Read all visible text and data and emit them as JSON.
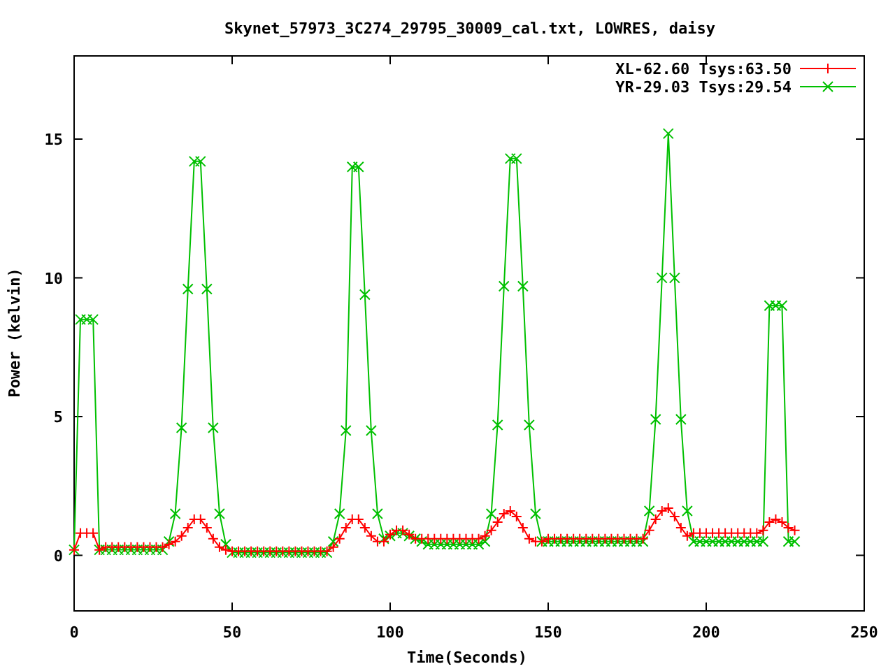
{
  "chart_data": {
    "type": "line",
    "title": "Skynet_57973_3C274_29795_30009_cal.txt, LOWRES, daisy",
    "xlabel": "Time(Seconds)",
    "ylabel": "Power (kelvin)",
    "legend": true,
    "xlim": [
      0,
      250
    ],
    "ylim": [
      -2,
      18
    ],
    "xticks": [
      0,
      50,
      100,
      150,
      200,
      250
    ],
    "yticks": [
      0,
      5,
      10,
      15
    ],
    "x": [
      0,
      2,
      4,
      6,
      8,
      10,
      12,
      14,
      16,
      18,
      20,
      22,
      24,
      26,
      28,
      30,
      32,
      34,
      36,
      38,
      40,
      42,
      44,
      46,
      48,
      50,
      52,
      54,
      56,
      58,
      60,
      62,
      64,
      66,
      68,
      70,
      72,
      74,
      76,
      78,
      80,
      82,
      84,
      86,
      88,
      90,
      92,
      94,
      96,
      98,
      100,
      102,
      104,
      106,
      108,
      110,
      112,
      114,
      116,
      118,
      120,
      122,
      124,
      126,
      128,
      130,
      132,
      134,
      136,
      138,
      140,
      142,
      144,
      146,
      148,
      150,
      152,
      154,
      156,
      158,
      160,
      162,
      164,
      166,
      168,
      170,
      172,
      174,
      176,
      178,
      180,
      182,
      184,
      186,
      188,
      190,
      192,
      194,
      196,
      198,
      200,
      202,
      204,
      206,
      208,
      210,
      212,
      214,
      216,
      218,
      220,
      222,
      224,
      226,
      228
    ],
    "series": [
      {
        "name": "XL-62.60 Tsys:63.50",
        "color": "#ff0000",
        "marker": "plus",
        "values": [
          0.2,
          0.8,
          0.8,
          0.8,
          0.2,
          0.3,
          0.3,
          0.3,
          0.3,
          0.3,
          0.3,
          0.3,
          0.3,
          0.3,
          0.3,
          0.4,
          0.5,
          0.7,
          1.0,
          1.3,
          1.3,
          1.0,
          0.6,
          0.3,
          0.2,
          0.15,
          0.15,
          0.15,
          0.15,
          0.15,
          0.15,
          0.15,
          0.15,
          0.15,
          0.15,
          0.15,
          0.15,
          0.15,
          0.15,
          0.15,
          0.15,
          0.3,
          0.6,
          1.0,
          1.3,
          1.3,
          1.0,
          0.7,
          0.5,
          0.5,
          0.75,
          0.9,
          0.9,
          0.75,
          0.6,
          0.6,
          0.6,
          0.6,
          0.6,
          0.6,
          0.6,
          0.6,
          0.6,
          0.6,
          0.6,
          0.7,
          0.9,
          1.2,
          1.5,
          1.6,
          1.4,
          1.0,
          0.6,
          0.5,
          0.5,
          0.6,
          0.6,
          0.6,
          0.6,
          0.6,
          0.6,
          0.6,
          0.6,
          0.6,
          0.6,
          0.6,
          0.6,
          0.6,
          0.6,
          0.6,
          0.6,
          0.9,
          1.3,
          1.6,
          1.7,
          1.4,
          1.0,
          0.7,
          0.8,
          0.8,
          0.8,
          0.8,
          0.8,
          0.8,
          0.8,
          0.8,
          0.8,
          0.8,
          0.8,
          0.9,
          1.2,
          1.3,
          1.2,
          1.0,
          0.9
        ]
      },
      {
        "name": "YR-29.03 Tsys:29.54",
        "color": "#00c000",
        "marker": "cross",
        "values": [
          0.2,
          8.5,
          8.5,
          8.5,
          0.2,
          0.2,
          0.2,
          0.2,
          0.2,
          0.2,
          0.2,
          0.2,
          0.2,
          0.2,
          0.2,
          0.5,
          1.5,
          4.6,
          9.6,
          14.2,
          14.2,
          9.6,
          4.6,
          1.5,
          0.4,
          0.1,
          0.1,
          0.1,
          0.1,
          0.1,
          0.1,
          0.1,
          0.1,
          0.1,
          0.1,
          0.1,
          0.1,
          0.1,
          0.1,
          0.1,
          0.1,
          0.5,
          1.5,
          4.5,
          14.0,
          14.0,
          9.4,
          4.5,
          1.5,
          0.6,
          0.7,
          0.8,
          0.8,
          0.7,
          0.6,
          0.5,
          0.4,
          0.4,
          0.4,
          0.4,
          0.4,
          0.4,
          0.4,
          0.4,
          0.4,
          0.5,
          1.5,
          4.7,
          9.7,
          14.3,
          14.3,
          9.7,
          4.7,
          1.5,
          0.5,
          0.5,
          0.5,
          0.5,
          0.5,
          0.5,
          0.5,
          0.5,
          0.5,
          0.5,
          0.5,
          0.5,
          0.5,
          0.5,
          0.5,
          0.5,
          0.5,
          1.6,
          4.9,
          10.0,
          15.2,
          10.0,
          4.9,
          1.6,
          0.5,
          0.5,
          0.5,
          0.5,
          0.5,
          0.5,
          0.5,
          0.5,
          0.5,
          0.5,
          0.5,
          0.5,
          9.0,
          9.0,
          9.0,
          0.5,
          0.5
        ]
      }
    ]
  }
}
